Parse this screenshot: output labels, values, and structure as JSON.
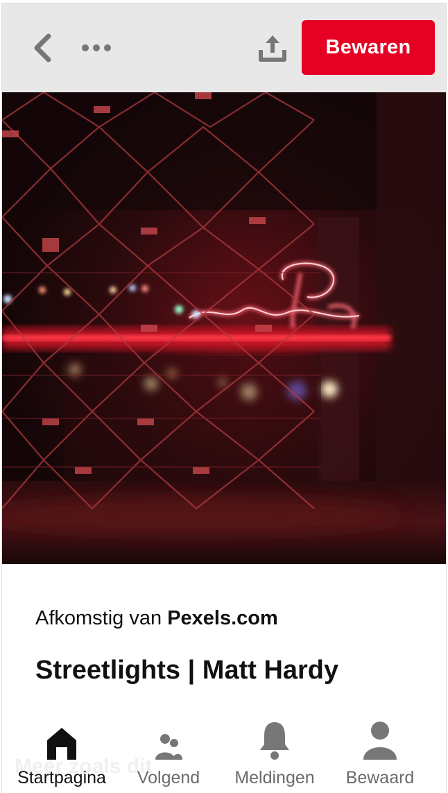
{
  "header": {
    "save_label": "Bewaren"
  },
  "colors": {
    "accent": "#e60023",
    "header_bg": "#e8e8e8",
    "icon_gray": "#777777"
  },
  "pin": {
    "source_prefix": "Afkomstig van",
    "source_domain": "Pexels.com",
    "title": "Streetlights | Matt Hardy",
    "more_like_this": "Meer zoals dit"
  },
  "nav": {
    "items": [
      {
        "label": "Startpagina",
        "icon": "home-icon",
        "active": true
      },
      {
        "label": "Volgend",
        "icon": "people-icon",
        "active": false
      },
      {
        "label": "Meldingen",
        "icon": "bell-icon",
        "active": false
      },
      {
        "label": "Bewaard",
        "icon": "person-icon",
        "active": false
      }
    ]
  }
}
